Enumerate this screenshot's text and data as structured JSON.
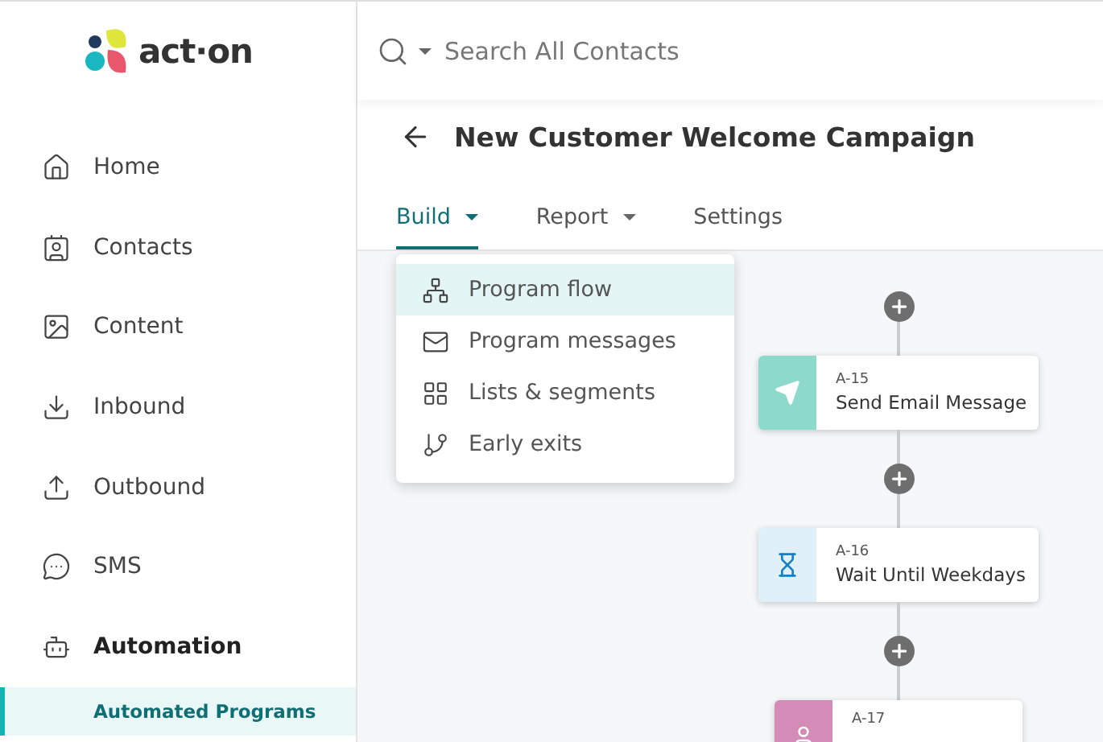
{
  "logo": {
    "text": "act·on"
  },
  "sidebar": {
    "items": [
      {
        "label": "Home",
        "selected": false
      },
      {
        "label": "Contacts",
        "selected": false
      },
      {
        "label": "Content",
        "selected": false
      },
      {
        "label": "Inbound",
        "selected": false
      },
      {
        "label": "Outbound",
        "selected": false
      },
      {
        "label": "SMS",
        "selected": false
      },
      {
        "label": "Automation",
        "selected": true,
        "children": [
          {
            "label": "Automated Programs",
            "selected": true
          }
        ]
      }
    ]
  },
  "search": {
    "placeholder": "Search All Contacts"
  },
  "page": {
    "title": "New Customer Welcome Campaign"
  },
  "tabs": [
    {
      "label": "Build",
      "selected": true,
      "kind": "dropdown"
    },
    {
      "label": "Report",
      "selected": false,
      "kind": "dropdown"
    },
    {
      "label": "Settings",
      "selected": false,
      "kind": "plain"
    }
  ],
  "build_menu": {
    "items": [
      {
        "label": "Program flow",
        "selected": true
      },
      {
        "label": "Program messages",
        "selected": false
      },
      {
        "label": "Lists & segments",
        "selected": false
      },
      {
        "label": "Early exits",
        "selected": false
      }
    ]
  },
  "flow": {
    "steps": [
      {
        "kind": "email",
        "id": "A-15",
        "name": "Send Email Message"
      },
      {
        "kind": "wait",
        "id": "A-16",
        "name": "Wait Until Weekdays"
      },
      {
        "kind": "other",
        "id": "A-17"
      }
    ]
  }
}
